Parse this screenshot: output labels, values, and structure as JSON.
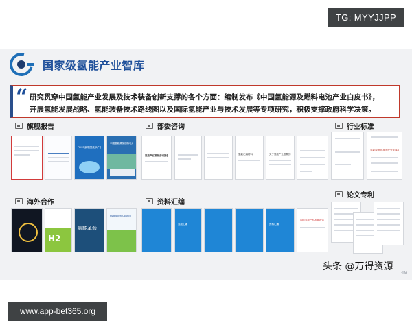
{
  "overlay": {
    "tg_badge": "TG: MYYJJPP",
    "url_badge": "www.app-bet365.org",
    "watermark": "头条 @万得资源"
  },
  "slide": {
    "title": "国家级氢能产业智库",
    "quote_mark": "“",
    "quote_line1": "研究贯穿中国氢能产业发展及技术装备创新支撑的各个方面：编制发布《中国氢能源及燃料电池产业白皮书》，",
    "quote_line2": "开展氢能发展战略、氢能装备技术路线图以及国际氢能产业与技术发展等专项研究，积极支撑政府科学决策。",
    "page_number": "49",
    "sections": {
      "flagship": "旗舰报告",
      "ministry": "部委咨询",
      "standards": "行业标准",
      "overseas": "海外合作",
      "compilation": "资料汇编",
      "papers": "论文专利"
    },
    "flagship_caps": [
      "",
      "",
      "PEM电解制氢技术产业手册",
      "中国氢能源及燃料电池产业白皮书"
    ],
    "ministry_caps": [
      "氢能产业发展咨询报告",
      "",
      "",
      "氢能汇编材料",
      "关于氢能产业发展的专题研究报告"
    ],
    "standards_caps": [
      "",
      "氢能源·燃料电池产业发展标准"
    ],
    "overseas_caps": [
      "",
      "H2",
      "氢能革命",
      "Hydrogen Council"
    ],
    "compilation_caps": [
      "",
      "氢能汇编",
      "",
      "",
      "资料汇编",
      "国际氢能产业发展报告"
    ],
    "papers_caps": [
      "",
      "",
      ""
    ]
  },
  "colors": {
    "title_blue": "#1e4f9a",
    "report_blue": "#1f6fbf",
    "highlight_red": "#d23b3b",
    "badge_gray": "#3f4244"
  }
}
